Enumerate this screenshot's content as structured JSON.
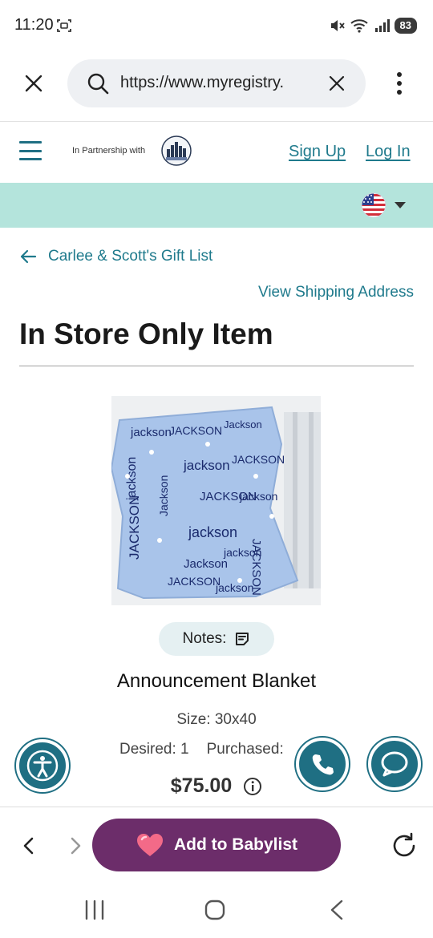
{
  "status_bar": {
    "time": "11:20",
    "battery": "83"
  },
  "browser": {
    "url": "https://www.myregistry.com/",
    "url_display": "https://www.myregistry."
  },
  "site_header": {
    "partnership_text": "In Partnership with",
    "signup_label": "Sign Up",
    "login_label": "Log In"
  },
  "page": {
    "back_link_label": "Carlee & Scott's Gift List",
    "shipping_link_label": "View Shipping Address",
    "title": "In Store Only Item"
  },
  "product": {
    "notes_label": "Notes:",
    "name": "Announcement Blanket",
    "size": "Size: 30x40",
    "desired": "Desired: 1",
    "purchased": "Purchased:",
    "price": "$75.00",
    "image_words": [
      "jackson",
      "JACKSON",
      "Jackson",
      "jackson",
      "JACKSON",
      "jackson",
      "Jackson",
      "JACKSON",
      "jackson",
      "jackson",
      "JACKSON",
      "Jackson",
      "jackson",
      "JACKSON",
      "jackson",
      "JACKSON"
    ]
  },
  "toolbar": {
    "babylist_label": "Add to Babylist"
  },
  "colors": {
    "teal": "#1f6f83",
    "link": "#1f7a8c",
    "mint_bar": "#b4e4dc",
    "babylist_purple": "#6c2d6a",
    "blanket_blue": "#a9c4ea",
    "blanket_text": "#1a2a6c"
  }
}
